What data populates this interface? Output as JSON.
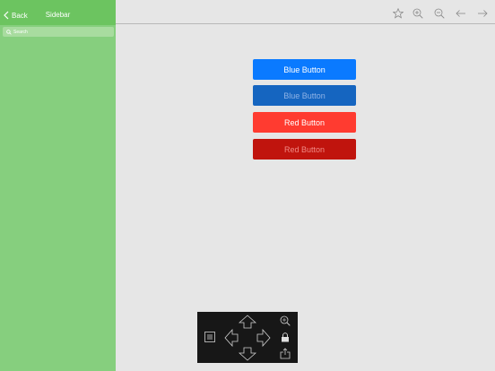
{
  "sidebar": {
    "back_label": "Back",
    "title": "Sidebar",
    "search_placeholder": "Search"
  },
  "toolbar": {
    "icons": [
      "star-icon",
      "zoom-in-icon",
      "zoom-out-icon",
      "arrow-left-icon",
      "arrow-right-icon"
    ]
  },
  "buttons": {
    "blue": "Blue Button",
    "blue_disabled": "Blue Button",
    "red": "Red Button",
    "red_disabled": "Red Button"
  },
  "colors": {
    "sidebar_bg": "#86cf7e",
    "sidebar_header": "#6cc460",
    "blue": "#0a7aff",
    "blue_disabled": "#1565c0",
    "red": "#ff3b30",
    "red_disabled": "#c0140d"
  },
  "control_pad": {
    "icons": [
      "arrow-up-icon",
      "arrow-left-icon",
      "arrow-right-icon",
      "arrow-down-icon",
      "list-icon",
      "zoom-icon",
      "lock-icon",
      "share-icon"
    ]
  }
}
